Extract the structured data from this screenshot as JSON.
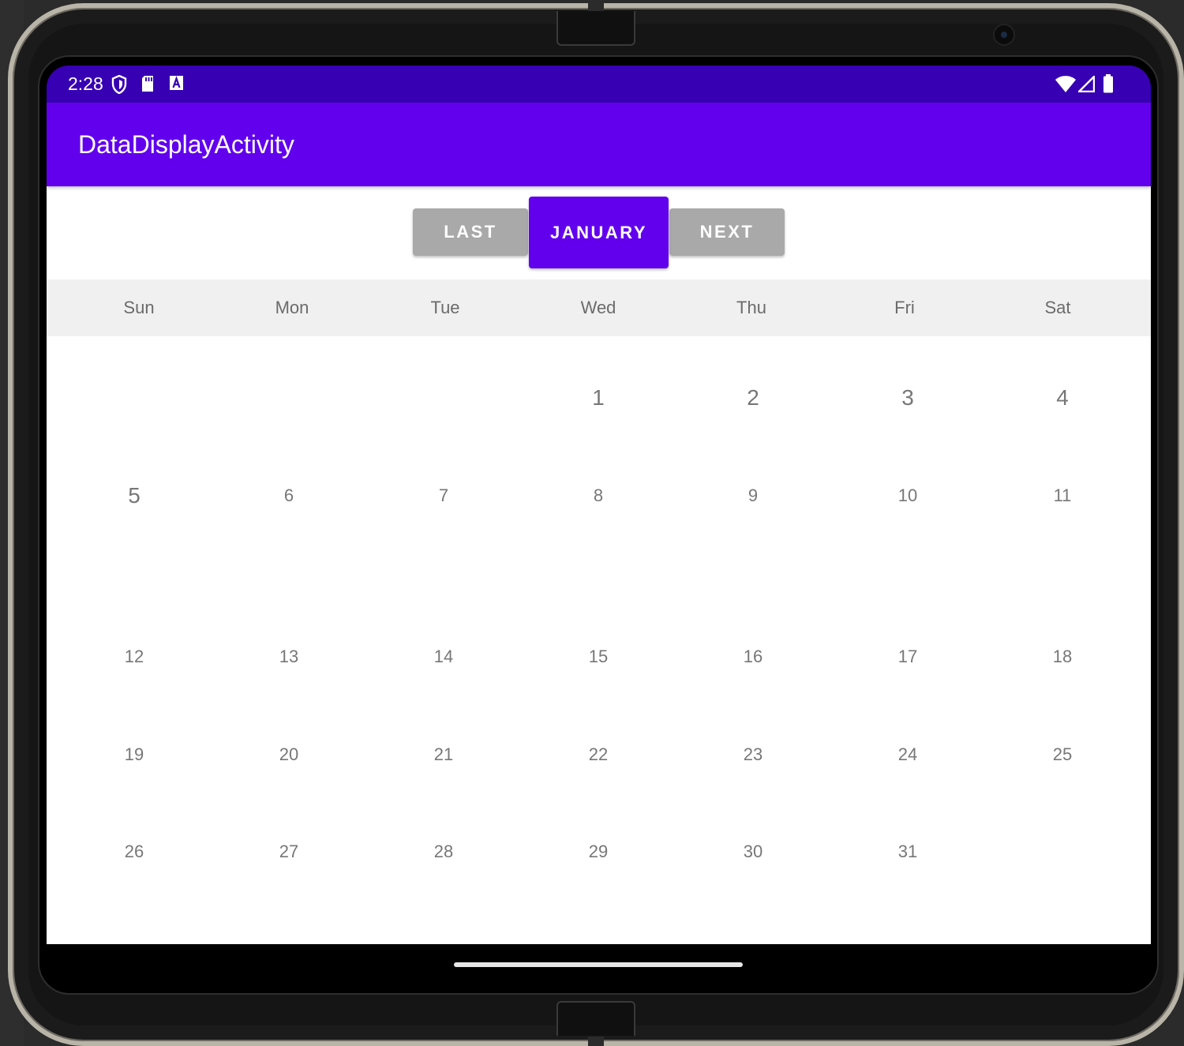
{
  "status_bar": {
    "time": "2:28",
    "left_icons": [
      "shield-icon",
      "sd-card-icon",
      "a-box-icon"
    ],
    "right_icons": [
      "wifi-icon",
      "cell-signal-icon",
      "battery-icon"
    ],
    "background": "#3700b3"
  },
  "app_bar": {
    "title": "DataDisplayActivity",
    "background": "#6200ee"
  },
  "controls": {
    "last_label": "LAST",
    "month_label": "JANUARY",
    "next_label": "NEXT"
  },
  "calendar": {
    "weekdays": [
      "Sun",
      "Mon",
      "Tue",
      "Wed",
      "Thu",
      "Fri",
      "Sat"
    ],
    "weeks": [
      [
        "",
        "",
        "",
        "1",
        "2",
        "3",
        "4"
      ],
      [
        "5",
        "6",
        "7",
        "8",
        "9",
        "10",
        "11"
      ],
      [
        "12",
        "13",
        "14",
        "15",
        "16",
        "17",
        "18"
      ],
      [
        "19",
        "20",
        "21",
        "22",
        "23",
        "24",
        "25"
      ],
      [
        "26",
        "27",
        "28",
        "29",
        "30",
        "31",
        ""
      ]
    ]
  }
}
